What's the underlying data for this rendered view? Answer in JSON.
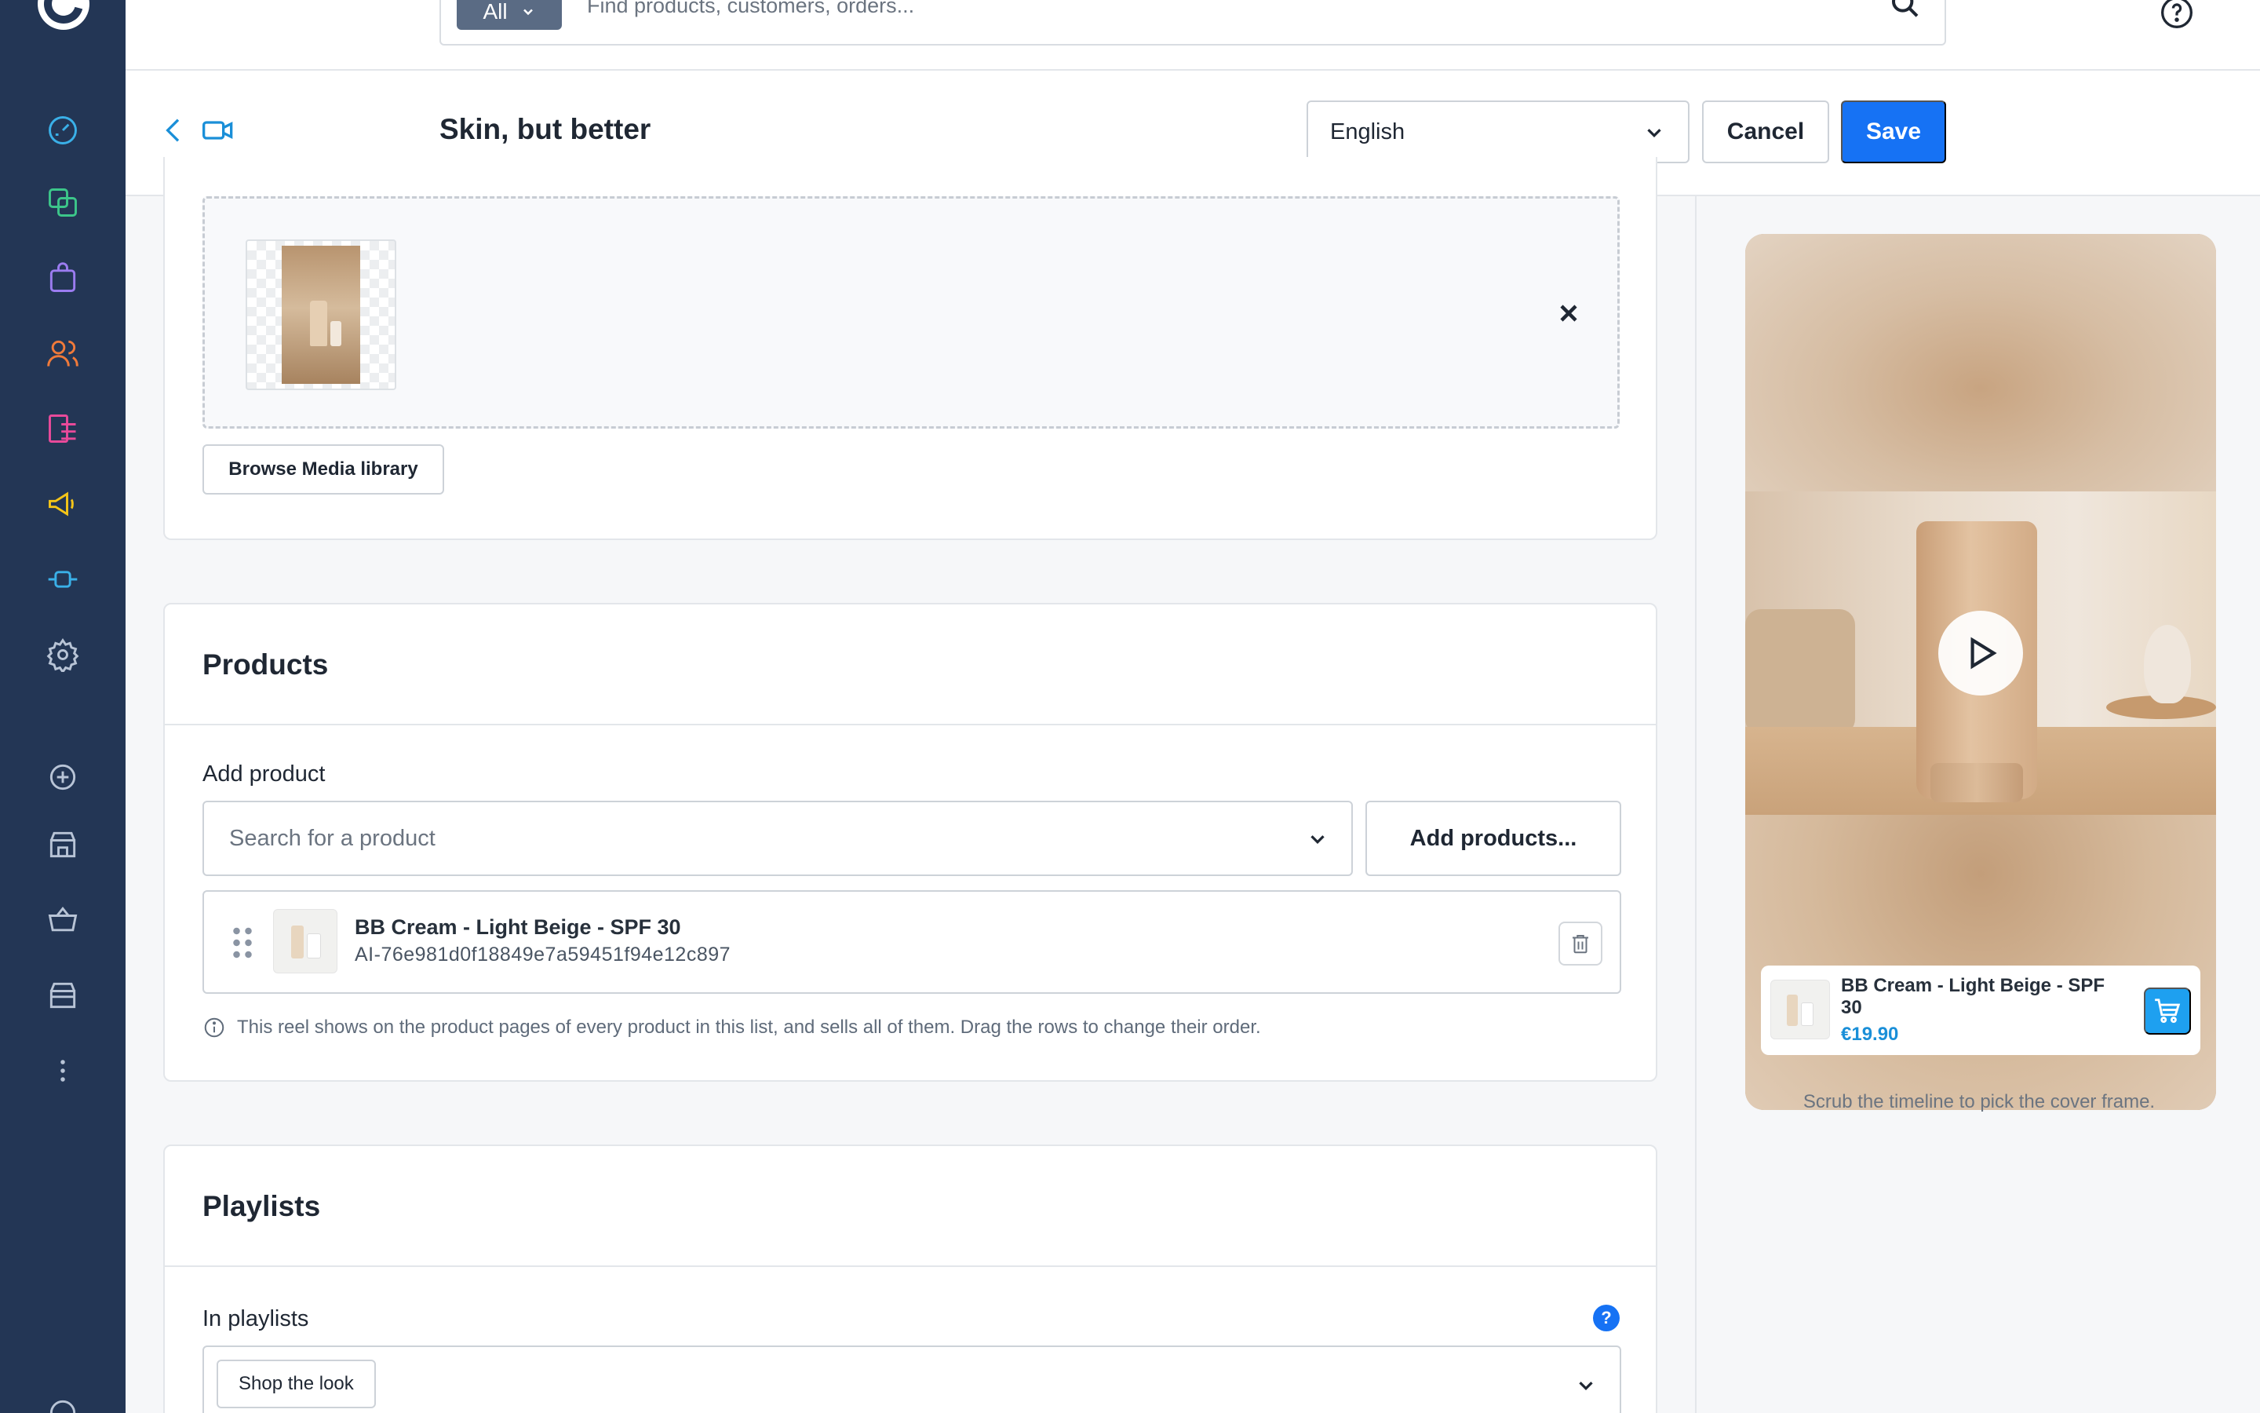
{
  "header": {
    "search_scope": "All",
    "search_placeholder": "Find products, customers, orders..."
  },
  "sidebar": {
    "items": [
      {
        "icon": "dashboard-icon",
        "color": "#3ab0e8"
      },
      {
        "icon": "catalog-icon",
        "color": "#3cc68a"
      },
      {
        "icon": "orders-bag-icon",
        "color": "#9b7cf0"
      },
      {
        "icon": "customers-icon",
        "color": "#f07a3a"
      },
      {
        "icon": "content-icon",
        "color": "#e84a9a"
      },
      {
        "icon": "marketing-megaphone-icon",
        "color": "#f5c518"
      },
      {
        "icon": "integrations-icon",
        "color": "#3ab0e8"
      },
      {
        "icon": "settings-gear-icon",
        "color": "#b8c4d6"
      },
      {
        "icon": "add-circle-icon",
        "color": "#b8c4d6"
      },
      {
        "icon": "store-icon",
        "color": "#b8c4d6"
      },
      {
        "icon": "basket-icon",
        "color": "#b8c4d6"
      },
      {
        "icon": "store-alt-icon",
        "color": "#b8c4d6"
      },
      {
        "icon": "more-icon",
        "color": "#b8c4d6"
      }
    ]
  },
  "title_bar": {
    "title": "Skin, but better",
    "language": "English",
    "cancel_label": "Cancel",
    "save_label": "Save",
    "accent_color": "#1672f4"
  },
  "media": {
    "browse_label": "Browse Media library"
  },
  "products": {
    "title": "Products",
    "add_label": "Add product",
    "search_placeholder": "Search for a product",
    "add_button": "Add products...",
    "items": [
      {
        "name": "BB Cream - Light Beige - SPF 30",
        "sku": "AI-76e981d0f18849e7a59451f94e12c897"
      }
    ],
    "info_text": "This reel shows on the product pages of every product in this list, and sells all of them. Drag the rows to change their order."
  },
  "playlists": {
    "title": "Playlists",
    "label": "In playlists",
    "help": "?",
    "selected": [
      "Shop the look"
    ]
  },
  "preview": {
    "product_name": "BB Cream - Light Beige - SPF 30",
    "price": "€19.90",
    "hint": "Scrub the timeline to pick the cover frame."
  }
}
